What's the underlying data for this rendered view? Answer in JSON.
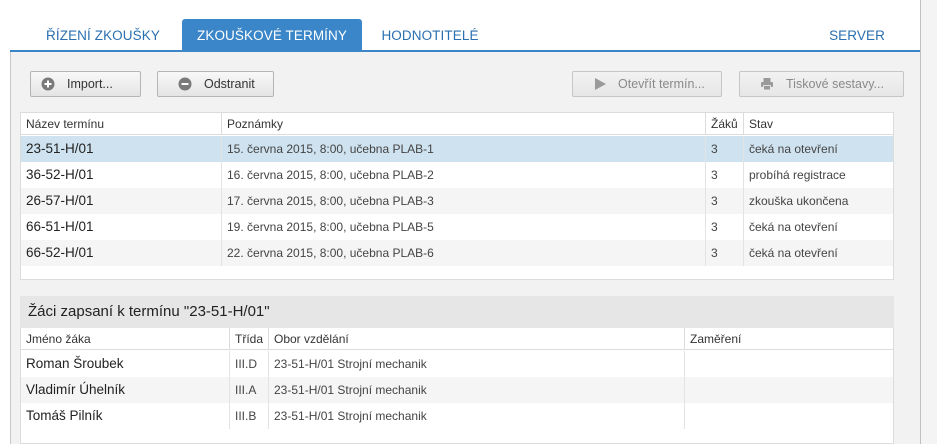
{
  "tabs": [
    {
      "label": "ŘÍZENÍ ZKOUŠKY"
    },
    {
      "label": "ZKOUŠKOVÉ TERMÍNY"
    },
    {
      "label": "HODNOTITELÉ"
    },
    {
      "label": "SERVER"
    }
  ],
  "toolbar": {
    "import_label": "Import...",
    "remove_label": "Odstranit",
    "open_label": "Otevřít termín...",
    "print_label": "Tiskové sestavy..."
  },
  "terms": {
    "columns": [
      "Název termínu",
      "Poznámky",
      "Žáků",
      "Stav"
    ],
    "rows": [
      {
        "name": "23-51-H/01",
        "note": "15. června 2015, 8:00, učebna PLAB-1",
        "count": "3",
        "state": "čeká na otevření"
      },
      {
        "name": "36-52-H/01",
        "note": "16. června 2015, 8:00, učebna PLAB-2",
        "count": "3",
        "state": "probíhá registrace"
      },
      {
        "name": "26-57-H/01",
        "note": "17. června 2015, 8:00, učebna PLAB-3",
        "count": "3",
        "state": "zkouška ukončena"
      },
      {
        "name": "66-51-H/01",
        "note": "19. června 2015, 8:00, učebna PLAB-5",
        "count": "3",
        "state": "čeká na otevření"
      },
      {
        "name": "66-52-H/01",
        "note": "22. června 2015, 8:00, učebna PLAB-6",
        "count": "3",
        "state": "čeká na otevření"
      }
    ]
  },
  "students": {
    "title": "Žáci zapsaní k termínu \"23-51-H/01\"",
    "columns": [
      "Jméno žáka",
      "Třída",
      "Obor vzdělání",
      "Zaměření"
    ],
    "rows": [
      {
        "name": "Roman Šroubek",
        "class": "III.D",
        "field": "23-51-H/01 Strojní mechanik",
        "focus": ""
      },
      {
        "name": "Vladimír Úhelník",
        "class": "III.A",
        "field": "23-51-H/01 Strojní mechanik",
        "focus": ""
      },
      {
        "name": "Tomáš Pilník",
        "class": "III.B",
        "field": "23-51-H/01 Strojní mechanik",
        "focus": ""
      }
    ]
  },
  "colors": {
    "accent": "#3a86c8",
    "selected_row": "#cfe2ef"
  }
}
